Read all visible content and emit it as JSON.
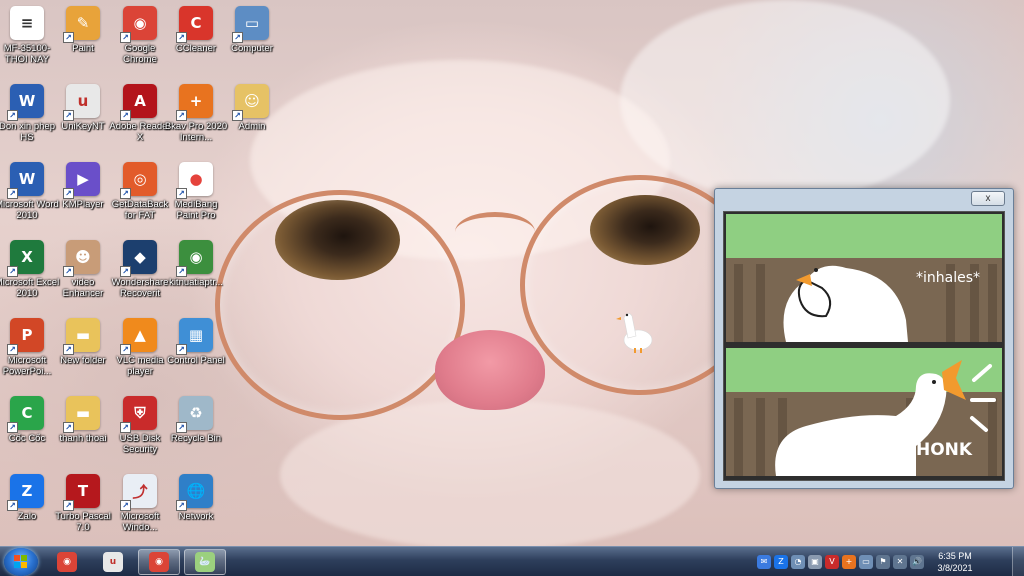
{
  "desktop": {
    "icons": [
      {
        "label": "MF-35100-THOI NAY",
        "icon": "pdf-document-icon",
        "color": "#ffffff",
        "glyph": "≡",
        "glyph_color": "#333333"
      },
      {
        "label": "Paint",
        "icon": "paint-palette-icon",
        "color": "#e8a33a",
        "glyph": "✎"
      },
      {
        "label": "Google Chrome",
        "icon": "chrome-icon",
        "color": "#db4437",
        "glyph": "◉"
      },
      {
        "label": "CCleaner",
        "icon": "ccleaner-icon",
        "color": "#d9352b",
        "glyph": "C"
      },
      {
        "label": "Computer",
        "icon": "computer-icon",
        "color": "#5d8dc4",
        "glyph": "▭"
      },
      {
        "label": "Don xin phep HS",
        "icon": "word-document-icon",
        "color": "#2b5fb3",
        "glyph": "W"
      },
      {
        "label": "UniKeyNT",
        "icon": "unikey-icon",
        "color": "#e8e8e8",
        "glyph": "u",
        "glyph_color": "#c0302b"
      },
      {
        "label": "Adobe Reader X",
        "icon": "adobe-reader-icon",
        "color": "#b3141b",
        "glyph": "A"
      },
      {
        "label": "Bkav Pro 2020 Intern...",
        "icon": "bkav-shield-icon",
        "color": "#e8731f",
        "glyph": "+"
      },
      {
        "label": "Admin",
        "icon": "user-folder-icon",
        "color": "#e6c265",
        "glyph": "☺"
      },
      {
        "label": "Microsoft Word 2010",
        "icon": "word-icon",
        "color": "#2b5fb3",
        "glyph": "W"
      },
      {
        "label": "KMPlayer",
        "icon": "kmplayer-icon",
        "color": "#6a4fc9",
        "glyph": "▶"
      },
      {
        "label": "GetDataBack for FAT",
        "icon": "lifebuoy-icon",
        "color": "#e25b2a",
        "glyph": "◎"
      },
      {
        "label": "MediBang Paint Pro",
        "icon": "medibang-icon",
        "color": "#ffffff",
        "glyph": "●",
        "glyph_color": "#e5433c"
      },
      {
        "label": "Microsoft Excel 2010",
        "icon": "excel-icon",
        "color": "#1f7a3d",
        "glyph": "X"
      },
      {
        "label": "video Enhancer",
        "icon": "video-thumbnail-icon",
        "color": "#c89c78",
        "glyph": "☻"
      },
      {
        "label": "Wondershare Recoverit",
        "icon": "recoverit-icon",
        "color": "#1c3f6e",
        "glyph": "◆"
      },
      {
        "label": "kitnuatiaptr...",
        "icon": "chrome-icon",
        "color": "#3c8f3e",
        "glyph": "◉"
      },
      {
        "label": "Microsoft PowerPoi...",
        "icon": "powerpoint-icon",
        "color": "#d24726",
        "glyph": "P"
      },
      {
        "label": "New folder",
        "icon": "folder-icon",
        "color": "#e9c35b",
        "glyph": "▬"
      },
      {
        "label": "VLC media player",
        "icon": "vlc-cone-icon",
        "color": "#f08a1c",
        "glyph": "▲"
      },
      {
        "label": "Control Panel",
        "icon": "control-panel-icon",
        "color": "#3f8fd6",
        "glyph": "▦"
      },
      {
        "label": "Cốc Cốc",
        "icon": "coccoc-icon",
        "color": "#2aa54a",
        "glyph": "C"
      },
      {
        "label": "thanh thoai",
        "icon": "folder-icon",
        "color": "#e9c35b",
        "glyph": "▬"
      },
      {
        "label": "USB Disk Security",
        "icon": "usb-shield-icon",
        "color": "#c92b2b",
        "glyph": "⛨"
      },
      {
        "label": "Recycle Bin",
        "icon": "recycle-bin-icon",
        "color": "#9fb8c9",
        "glyph": "♻"
      },
      {
        "label": "Zalo",
        "icon": "zalo-icon",
        "color": "#1a73e8",
        "glyph": "Z"
      },
      {
        "label": "Turbo Pascal 7.0",
        "icon": "turbo-pascal-icon",
        "color": "#b5181d",
        "glyph": "T"
      },
      {
        "label": "Microsoft Windo...",
        "icon": "windows-installer-icon",
        "color": "#e9eef5",
        "glyph": "⤴",
        "glyph_color": "#c03030"
      },
      {
        "label": "Network",
        "icon": "network-globe-icon",
        "color": "#2f7fc8",
        "glyph": "🌐"
      }
    ]
  },
  "meme_window": {
    "close_label": "x",
    "panel_top_text": "*inhales*",
    "panel_bottom_text": "HONK"
  },
  "taskbar": {
    "items": [
      {
        "name": "taskbar-chrome",
        "icon": "chrome-icon",
        "color": "#db4437",
        "glyph": "◉",
        "active": false
      },
      {
        "name": "taskbar-unikey",
        "icon": "unikey-icon",
        "color": "#e8e8e8",
        "glyph": "u",
        "active": false
      },
      {
        "name": "taskbar-chrome-window",
        "icon": "chrome-icon",
        "color": "#db4437",
        "glyph": "◉",
        "active": true
      },
      {
        "name": "taskbar-goose-app",
        "icon": "goose-icon",
        "color": "#9bd07e",
        "glyph": "🦢",
        "active": true
      }
    ],
    "tray_icons": [
      {
        "icon": "messenger-icon",
        "color": "#3b7be0",
        "glyph": "✉"
      },
      {
        "icon": "zalo-tray-icon",
        "color": "#1a73e8",
        "glyph": "Z"
      },
      {
        "icon": "network-tray-icon",
        "color": "#6f8fb5",
        "glyph": "◔"
      },
      {
        "icon": "usb-tray-icon",
        "color": "#8a9ab0",
        "glyph": "▣"
      },
      {
        "icon": "vietnamese-keyboard-icon",
        "color": "#c92b2b",
        "glyph": "V"
      },
      {
        "icon": "bkav-tray-icon",
        "color": "#e8731f",
        "glyph": "+"
      },
      {
        "icon": "monitor-tray-icon",
        "color": "#6f8fb5",
        "glyph": "▭"
      },
      {
        "icon": "flag-tray-icon",
        "color": "#5f7590",
        "glyph": "⚑"
      },
      {
        "icon": "action-center-icon",
        "color": "#5f7590",
        "glyph": "✕"
      },
      {
        "icon": "volume-icon",
        "color": "#5f7590",
        "glyph": "🔊"
      }
    ],
    "clock_time": "6:35 PM",
    "clock_date": "3/8/2021"
  }
}
